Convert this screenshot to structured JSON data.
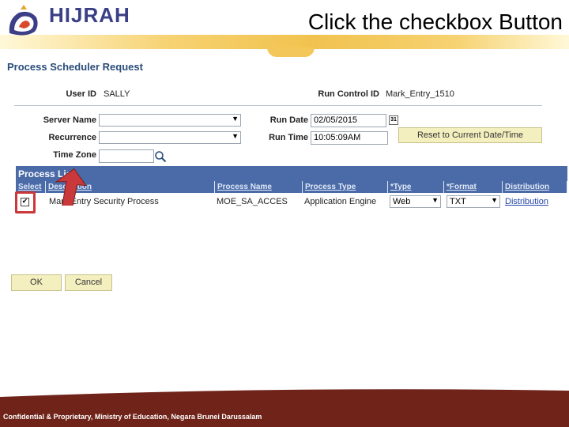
{
  "slide": {
    "logo_text": "HIJRAH",
    "title": "Click the checkbox Button",
    "footer": "Confidential & Proprietary, Ministry of Education, Negara Brunei Darussalam"
  },
  "page": {
    "title": "Process Scheduler Request",
    "user_id_label": "User ID",
    "user_id_value": "SALLY",
    "run_control_label": "Run Control ID",
    "run_control_value": "Mark_Entry_1510",
    "server_name_label": "Server Name",
    "server_name_value": "",
    "recurrence_label": "Recurrence",
    "recurrence_value": "",
    "time_zone_label": "Time Zone",
    "time_zone_value": "",
    "run_date_label": "Run Date",
    "run_date_value": "02/05/2015",
    "run_time_label": "Run Time",
    "run_time_value": "10:05:09AM",
    "reset_button": "Reset to Current Date/Time",
    "calendar_icon_text": "31"
  },
  "process_list": {
    "title": "Process List",
    "columns": [
      "Select",
      "Description",
      "Process Name",
      "Process Type",
      "*Type",
      "*Format",
      "Distribution"
    ],
    "rows": [
      {
        "selected": true,
        "description": "Mark Entry Security Process",
        "process_name": "MOE_SA_ACCES",
        "process_type": "Application Engine",
        "type": "Web",
        "format": "TXT",
        "distribution": "Distribution"
      }
    ]
  },
  "buttons": {
    "ok": "OK",
    "cancel": "Cancel"
  },
  "colors": {
    "grid_header": "#4a6aa8",
    "highlight": "#c9383a",
    "button": "#f4efbf",
    "footer": "#6f2319"
  },
  "icons": {
    "search": "search-icon",
    "calendar": "calendar-icon",
    "pointer": "arrow-pointer-icon"
  }
}
